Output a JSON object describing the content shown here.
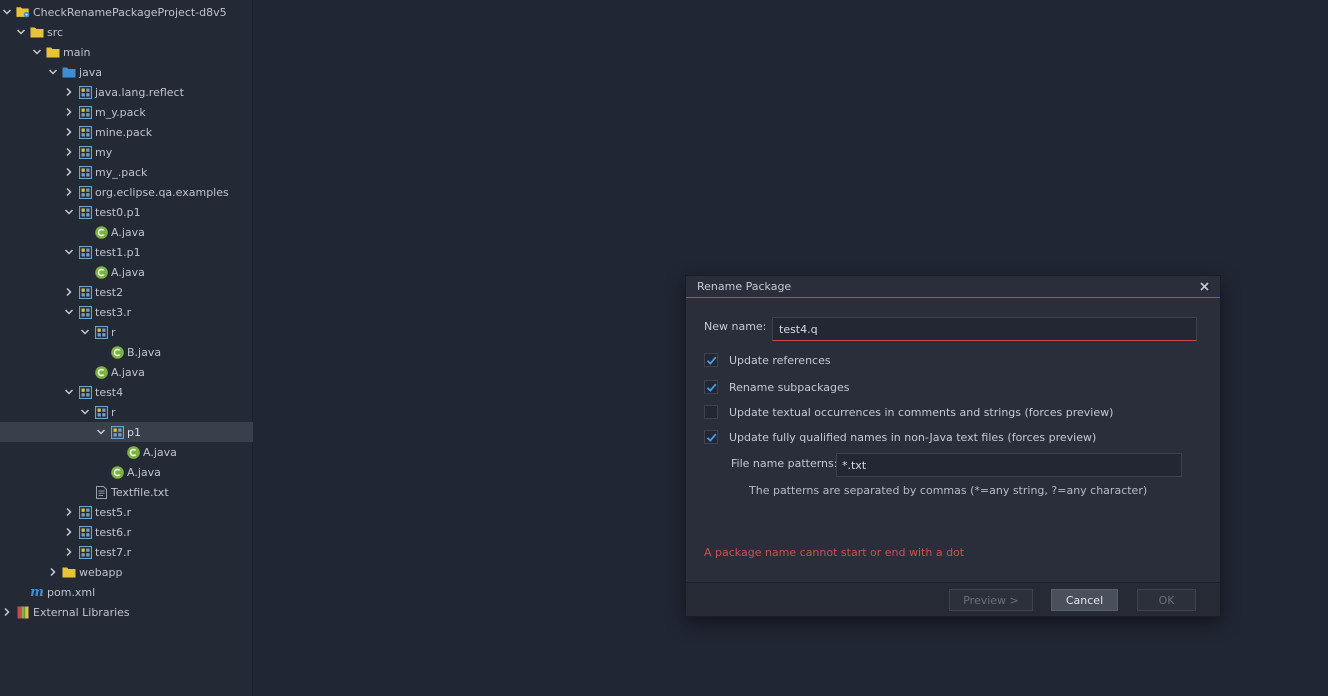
{
  "tree": [
    {
      "label": "CheckRenamePackageProject-d8v5",
      "level": 0,
      "chevron": "down",
      "icon": "project-folder-icon",
      "selected": false
    },
    {
      "label": "src",
      "level": 1,
      "chevron": "down",
      "icon": "folder-icon",
      "selected": false
    },
    {
      "label": "main",
      "level": 2,
      "chevron": "down",
      "icon": "folder-icon",
      "selected": false
    },
    {
      "label": "java",
      "level": 3,
      "chevron": "down",
      "icon": "source-folder-icon",
      "selected": false
    },
    {
      "label": "java.lang.reflect",
      "level": 4,
      "chevron": "right",
      "icon": "package-icon",
      "selected": false
    },
    {
      "label": "m_y.pack",
      "level": 4,
      "chevron": "right",
      "icon": "package-icon",
      "selected": false
    },
    {
      "label": "mine.pack",
      "level": 4,
      "chevron": "right",
      "icon": "package-icon",
      "selected": false
    },
    {
      "label": "my",
      "level": 4,
      "chevron": "right",
      "icon": "package-icon",
      "selected": false
    },
    {
      "label": "my_.pack",
      "level": 4,
      "chevron": "right",
      "icon": "package-icon",
      "selected": false
    },
    {
      "label": "org.eclipse.qa.examples",
      "level": 4,
      "chevron": "right",
      "icon": "package-icon",
      "selected": false
    },
    {
      "label": "test0.p1",
      "level": 4,
      "chevron": "down",
      "icon": "package-icon",
      "selected": false
    },
    {
      "label": "A.java",
      "level": 5,
      "chevron": "none",
      "icon": "java-class-icon",
      "selected": false
    },
    {
      "label": "test1.p1",
      "level": 4,
      "chevron": "down",
      "icon": "package-icon",
      "selected": false
    },
    {
      "label": "A.java",
      "level": 5,
      "chevron": "none",
      "icon": "java-class-icon",
      "selected": false
    },
    {
      "label": "test2",
      "level": 4,
      "chevron": "right",
      "icon": "package-icon",
      "selected": false
    },
    {
      "label": "test3.r",
      "level": 4,
      "chevron": "down",
      "icon": "package-icon",
      "selected": false
    },
    {
      "label": "r",
      "level": 5,
      "chevron": "down",
      "icon": "package-icon",
      "selected": false
    },
    {
      "label": "B.java",
      "level": 6,
      "chevron": "none",
      "icon": "java-class-icon",
      "selected": false
    },
    {
      "label": "A.java",
      "level": 5,
      "chevron": "none",
      "icon": "java-class-icon",
      "selected": false
    },
    {
      "label": "test4",
      "level": 4,
      "chevron": "down",
      "icon": "package-icon",
      "selected": false
    },
    {
      "label": "r",
      "level": 5,
      "chevron": "down",
      "icon": "package-icon",
      "selected": false
    },
    {
      "label": "p1",
      "level": 6,
      "chevron": "down",
      "icon": "package-icon",
      "selected": true
    },
    {
      "label": "A.java",
      "level": 7,
      "chevron": "none",
      "icon": "java-class-icon",
      "selected": false
    },
    {
      "label": "A.java",
      "level": 6,
      "chevron": "none",
      "icon": "java-class-icon",
      "selected": false
    },
    {
      "label": "Textfile.txt",
      "level": 5,
      "chevron": "none",
      "icon": "text-file-icon",
      "selected": false
    },
    {
      "label": "test5.r",
      "level": 4,
      "chevron": "right",
      "icon": "package-icon",
      "selected": false
    },
    {
      "label": "test6.r",
      "level": 4,
      "chevron": "right",
      "icon": "package-icon",
      "selected": false
    },
    {
      "label": "test7.r",
      "level": 4,
      "chevron": "right",
      "icon": "package-icon",
      "selected": false
    },
    {
      "label": "webapp",
      "level": 3,
      "chevron": "right",
      "icon": "folder-icon",
      "selected": false
    },
    {
      "label": "pom.xml",
      "level": 1,
      "chevron": "none",
      "icon": "maven-icon",
      "selected": false
    },
    {
      "label": "External Libraries",
      "level": 0,
      "chevron": "right",
      "icon": "libraries-icon",
      "selected": false
    }
  ],
  "dialog": {
    "title": "Rename Package",
    "new_name_label": "New name:",
    "new_name_value": "test4.q",
    "checkboxes": [
      {
        "label": "Update references",
        "checked": true
      },
      {
        "label": "Rename subpackages",
        "checked": true
      },
      {
        "label": "Update textual occurrences in comments and strings (forces preview)",
        "checked": false
      },
      {
        "label": "Update fully qualified names in non-Java text files (forces preview)",
        "checked": true
      }
    ],
    "file_patterns_label": "File name patterns:",
    "file_patterns_value": "*.txt",
    "patterns_hint": "The patterns are separated by commas (*=any string, ?=any character)",
    "error": "A package name cannot start or end with a dot",
    "buttons": {
      "preview": "Preview >",
      "cancel": "Cancel",
      "ok": "OK"
    }
  },
  "colors": {
    "background": "#212634",
    "panel": "#242936",
    "selection": "#3a3f4c",
    "folder": "#e8c33a",
    "source_folder": "#3a8fd8",
    "package": "#6fa3c9",
    "java_class": "#7cb342",
    "error": "#c8534f",
    "dialog_accent": "#4a6ea8"
  }
}
